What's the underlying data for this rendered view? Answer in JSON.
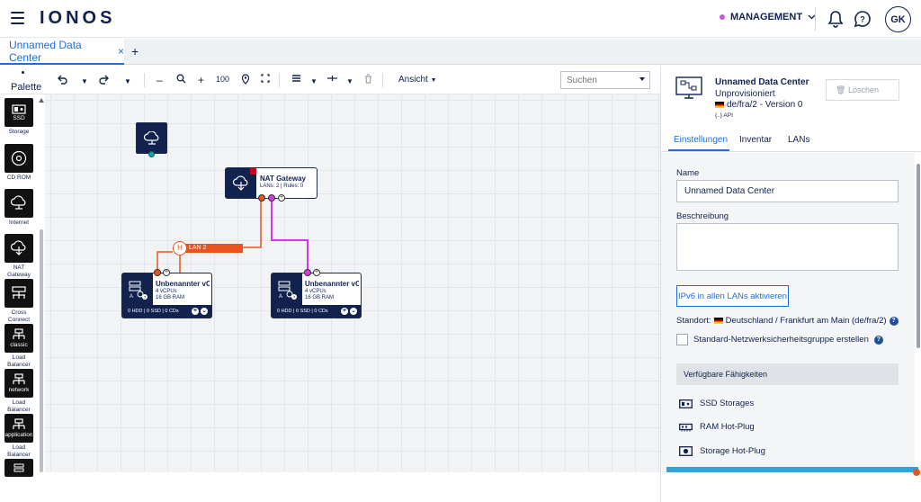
{
  "header": {
    "logo": "IONOS",
    "contract": "MANAGEMENT",
    "avatar_initials": "GK"
  },
  "tabs": [
    {
      "label": "Unnamed Data Center",
      "close": "×"
    }
  ],
  "tab_add": "+",
  "toolbar": {
    "palette_label": "Palette",
    "zoom": "100",
    "view_label": "Ansicht",
    "search_placeholder": "Suchen"
  },
  "palette": [
    {
      "tag": "SSD",
      "label": "Storage",
      "icon": "ssd-icon"
    },
    {
      "tag": "",
      "label": "CD ROM",
      "icon": "cd-icon"
    },
    {
      "tag": "",
      "label": "Internet",
      "icon": "internet-icon"
    },
    {
      "tag": "",
      "label": "NAT Gateway",
      "icon": "nat-gateway-icon"
    },
    {
      "tag": "",
      "label": "Cross Connect",
      "icon": "cross-connect-icon"
    },
    {
      "tag": "classic",
      "label": "Load Balancer",
      "icon": "load-balancer-icon"
    },
    {
      "tag": "network",
      "label": "Load Balancer",
      "icon": "load-balancer-icon"
    },
    {
      "tag": "application",
      "label": "Load Balancer",
      "icon": "load-balancer-icon"
    }
  ],
  "canvas": {
    "nat": {
      "title": "NAT Gateway",
      "sub": "LANs: 2 | Rules: 0"
    },
    "lan": {
      "label": "LAN 2",
      "hub": "H"
    },
    "servers": [
      {
        "title": "Unbenannter vC",
        "cpu": "4 vCPUs",
        "ram": "16 GB RAM",
        "footer": "0 HDD | 0 SSD | 0 CDs"
      },
      {
        "title": "Unbenannter vC",
        "cpu": "4 vCPUs",
        "ram": "16 GB RAM",
        "footer": "0 HDD | 0 SSD | 0 CDs"
      }
    ]
  },
  "panel": {
    "title": "Unnamed Data Center",
    "status": "Unprovisioniert",
    "location": "de/fra/2 - Version 0",
    "api": "{..} API",
    "delete_label": "Löschen",
    "tabs": [
      "Einstellungen",
      "Inventar",
      "LANs"
    ],
    "name_label": "Name",
    "name_value": "Unnamed Data Center",
    "desc_label": "Beschreibung",
    "desc_value": "",
    "ipv6_button": "IPv6 in allen LANs aktivieren",
    "standort_prefix": "Standort:",
    "standort_value": "Deutschland / Frankfurt am Main (de/fra/2)",
    "security_group_label": "Standard-Netzwerksicherheitsgruppe erstellen",
    "capabilities_header": "Verfügbare Fähigkeiten",
    "capabilities": [
      "SSD Storages",
      "RAM Hot-Plug",
      "Storage Hot-Plug"
    ]
  },
  "colors": {
    "accent": "#1d6ee0",
    "navy": "#11224e",
    "lan_orange": "#e9541c",
    "link_magenta": "#d23ae6"
  }
}
